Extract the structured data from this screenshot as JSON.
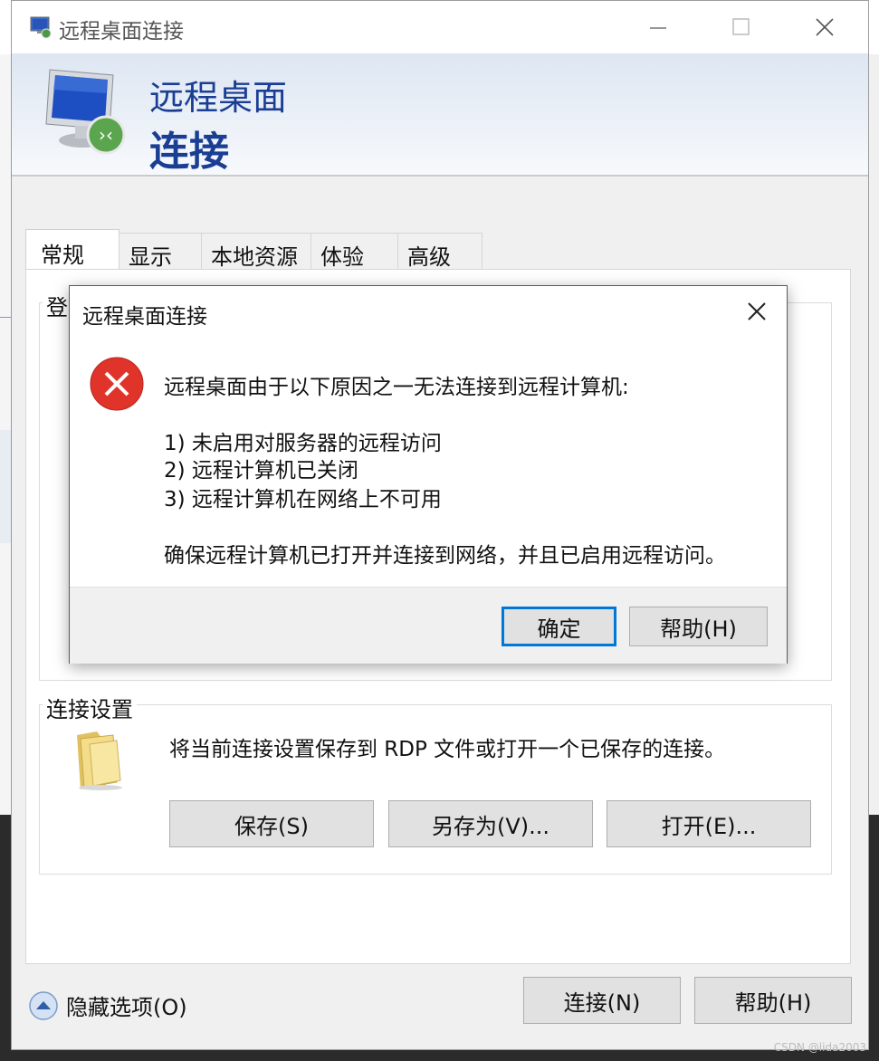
{
  "window": {
    "title": "远程桌面连接",
    "banner_line1": "远程桌面",
    "banner_line2": "连接"
  },
  "tabs": [
    {
      "label": "常规",
      "active": true
    },
    {
      "label": "显示",
      "active": false
    },
    {
      "label": "本地资源",
      "active": false
    },
    {
      "label": "体验",
      "active": false
    },
    {
      "label": "高级",
      "active": false
    }
  ],
  "login_group": {
    "label_partial": "登"
  },
  "connection_settings": {
    "label": "连接设置",
    "description": "将当前连接设置保存到 RDP 文件或打开一个已保存的连接。",
    "save_button": "保存(S)",
    "save_as_button": "另存为(V)...",
    "open_button": "打开(E)..."
  },
  "footer": {
    "hide_options": "隐藏选项(O)",
    "connect_button": "连接(N)",
    "help_button": "帮助(H)"
  },
  "error_dialog": {
    "title": "远程桌面连接",
    "message": "远程桌面由于以下原因之一无法连接到远程计算机:",
    "reasons": [
      "1) 未启用对服务器的远程访问",
      "2) 远程计算机已关闭",
      "3) 远程计算机在网络上不可用"
    ],
    "advice": "确保远程计算机已打开并连接到网络，并且已启用远程访问。",
    "ok_button": "确定",
    "help_button": "帮助(H)"
  },
  "watermark": "CSDN @lida2003",
  "colors": {
    "banner_text": "#1a3e94",
    "error_red": "#e0332a",
    "focus_blue": "#0078d7"
  }
}
